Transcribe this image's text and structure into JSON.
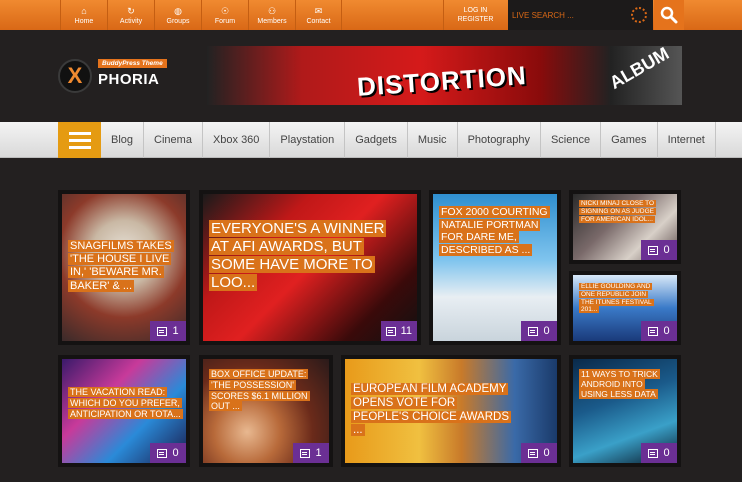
{
  "topnav": [
    {
      "label": "Home",
      "icon": "⌂",
      "icon_name": "home-icon"
    },
    {
      "label": "Activity",
      "icon": "↻",
      "icon_name": "activity-icon"
    },
    {
      "label": "Groups",
      "icon": "◍",
      "icon_name": "groups-icon"
    },
    {
      "label": "Forum",
      "icon": "☉",
      "icon_name": "forum-icon"
    },
    {
      "label": "Members",
      "icon": "⚇",
      "icon_name": "members-icon"
    },
    {
      "label": "Contact",
      "icon": "✉",
      "icon_name": "contact-icon"
    }
  ],
  "auth": {
    "login": "LOG IN",
    "register": "REGISTER"
  },
  "search": {
    "placeholder": "LIVE SEARCH ..."
  },
  "logo": {
    "tagline": "BuddyPress Theme",
    "mark": "X",
    "name": "PHORIA"
  },
  "banner": {
    "text_main": "DISTORTION",
    "text_side": "ALBUM"
  },
  "categories": [
    "Blog",
    "Cinema",
    "Xbox 360",
    "Playstation",
    "Gadgets",
    "Music",
    "Photography",
    "Science",
    "Games",
    "Internet"
  ],
  "posts": [
    {
      "title": "SNAGFILMS TAKES 'THE HOUSE I LIVE IN,' 'BEWARE MR. BAKER' & ...",
      "comments": "1"
    },
    {
      "title": "EVERYONE'S A WINNER AT AFI AWARDS, BUT SOME HAVE MORE TO LOO...",
      "comments": "11"
    },
    {
      "title": "FOX 2000 COURTING NATALIE PORTMAN FOR DARE ME, DESCRIBED AS ...",
      "comments": "0"
    },
    {
      "title": "NICKI MINAJ CLOSE TO SIGNING ON AS JUDGE FOR AMERICAN IDOL...",
      "comments": "0"
    },
    {
      "title": "ELLIE GOULDING AND ONE REPUBLIC JOIN THE ITUNES FESTIVAL 201...",
      "comments": "0"
    },
    {
      "title": "THE VACATION READ: WHICH DO YOU PREFER, ANTICIPATION OR TOTA...",
      "comments": "0"
    },
    {
      "title": "BOX OFFICE UPDATE: 'THE POSSESSION' SCORES $6.1 MILLION OUT ...",
      "comments": "1"
    },
    {
      "title": "EUROPEAN FILM ACADEMY OPENS VOTE FOR PEOPLE'S CHOICE AWARDS ...",
      "comments": "0"
    },
    {
      "title": "11 WAYS TO TRICK ANDROID INTO USING LESS DATA",
      "comments": "0"
    }
  ],
  "colors": {
    "accent": "#e5731c",
    "badge": "#6b2f94",
    "menu": "#e59b12"
  }
}
